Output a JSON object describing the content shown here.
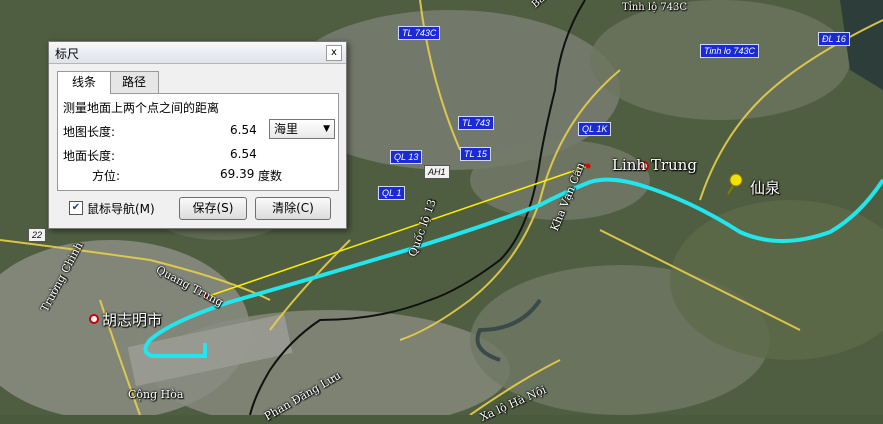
{
  "map": {
    "labels": {
      "linh_trung": "Linh Trung",
      "xian_quan": "仙泉",
      "hcm_city": "胡志明市",
      "quang_trung": "Quang Trung",
      "quoc_lo_13": "Quốc lộ 13",
      "kha_van_can": "Kha Vạn Cân",
      "truong_chinh": "Trường Chinh",
      "cong_hoa": "Cộng Hòa",
      "phan_dang_luu": "Phan Đăng Lưu",
      "xa_lo_ha_noi": "Xa lộ Hà Nội",
      "tinh_lo_743c": "Tỉnh lộ 743C",
      "bac_son": "Bắc Sơn",
      "route_22": "22"
    },
    "shields": {
      "tl743c_top": "TL 743C",
      "tl743c_right": "Tinh lo 743C",
      "dl16": "ĐL 16",
      "tl743": "TL 743",
      "ql1k": "QL 1K",
      "ql13": "QL 13",
      "tl15": "TL 15",
      "ql1": "QL 1",
      "ah1": "AH1"
    }
  },
  "dialog": {
    "title": "标尺",
    "close_label": "x",
    "tabs": [
      {
        "label": "线条",
        "active": true
      },
      {
        "label": "路径",
        "active": false
      }
    ],
    "description": "测量地面上两个点之间的距离",
    "map_length_label": "地图长度:",
    "map_length_value": "6.54",
    "unit_selected": "海里",
    "ground_length_label": "地面长度:",
    "ground_length_value": "6.54",
    "bearing_label": "方位:",
    "bearing_value": "69.39",
    "bearing_unit": "度数",
    "mouse_nav_label": "鼠标导航(M)",
    "mouse_nav_checked": true,
    "save_label": "保存(S)",
    "clear_label": "清除(C)"
  },
  "colors": {
    "path_line": "#22e6ee",
    "measure_line": "#ffee00",
    "road_line": "#111111"
  }
}
